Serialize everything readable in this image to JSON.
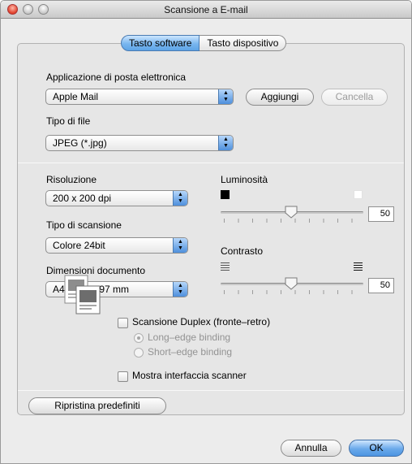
{
  "window": {
    "title": "Scansione a E-mail"
  },
  "tabs": [
    {
      "label": "Tasto software",
      "selected": true
    },
    {
      "label": "Tasto dispositivo",
      "selected": false
    }
  ],
  "email_app": {
    "label": "Applicazione di posta elettronica",
    "value": "Apple Mail",
    "add_label": "Aggiungi",
    "delete_label": "Cancella"
  },
  "file_type": {
    "label": "Tipo di file",
    "value": "JPEG (*.jpg)"
  },
  "resolution": {
    "label": "Risoluzione",
    "value": "200 x 200 dpi"
  },
  "scan_type": {
    "label": "Tipo di scansione",
    "value": "Colore 24bit"
  },
  "doc_size": {
    "label": "Dimensioni documento",
    "value": "A4  210 x 297 mm"
  },
  "brightness": {
    "label": "Luminosità",
    "value": "50"
  },
  "contrast": {
    "label": "Contrasto",
    "value": "50"
  },
  "duplex": {
    "label": "Scansione Duplex (fronte–retro)",
    "checked": false,
    "long_edge_label": "Long–edge binding",
    "short_edge_label": "Short–edge binding",
    "selected": "Long–edge binding"
  },
  "show_scanner_ui": {
    "label": "Mostra interfaccia scanner",
    "checked": false
  },
  "buttons": {
    "restore_defaults": "Ripristina predefiniti",
    "cancel": "Annulla",
    "ok": "OK"
  },
  "colors": {
    "accent": "#5ea4e6",
    "panel": "#e6e6e6",
    "window": "#ececec"
  }
}
